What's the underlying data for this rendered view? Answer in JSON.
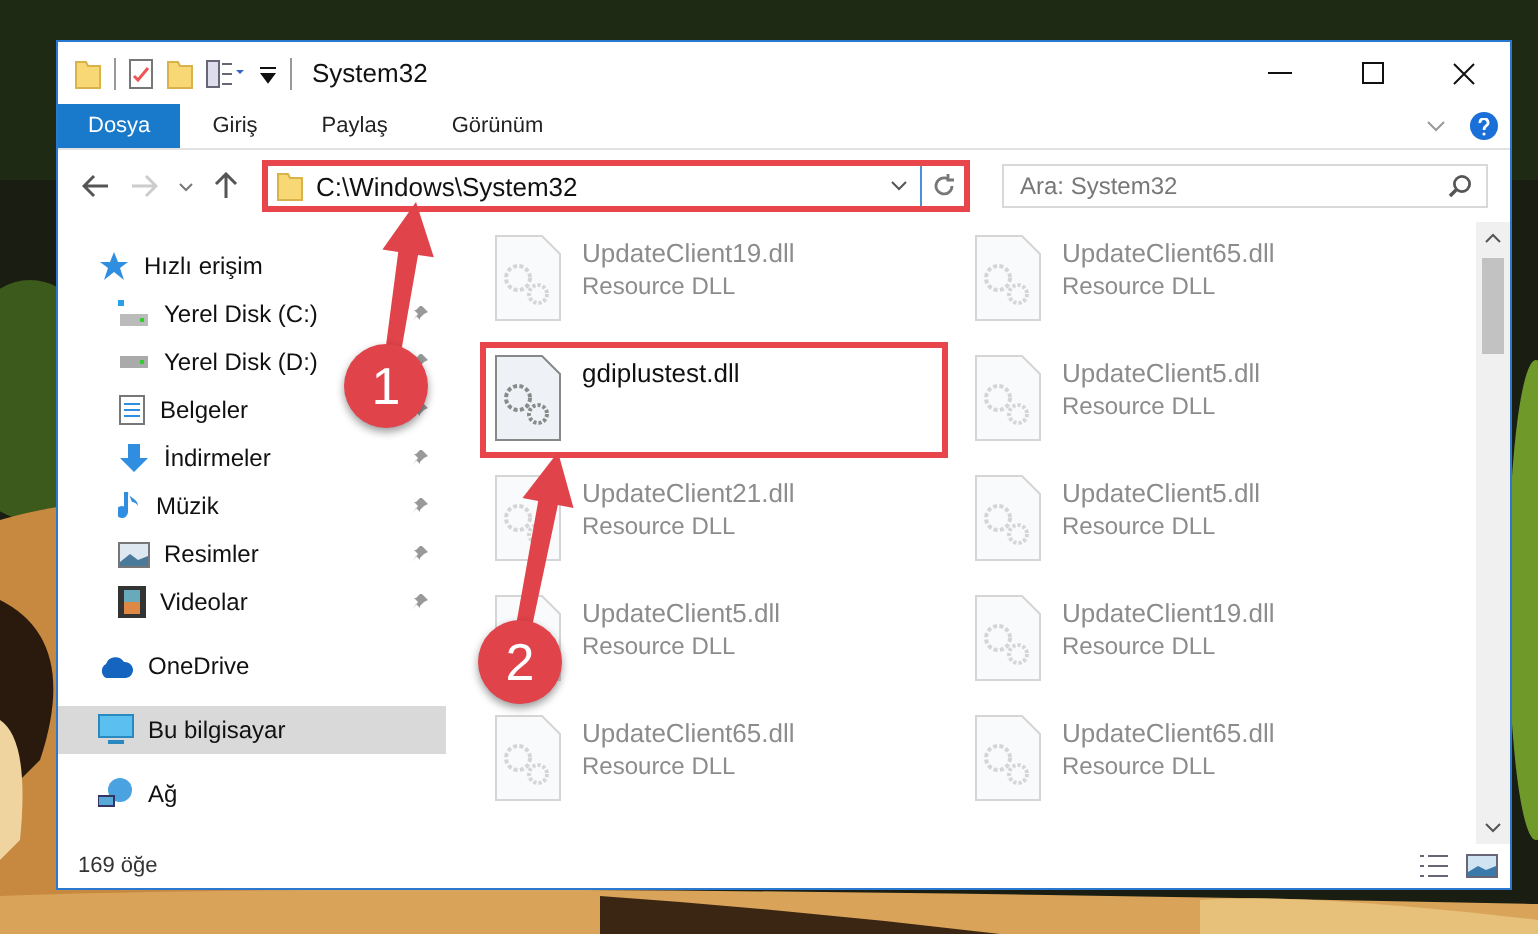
{
  "window": {
    "title": "System32"
  },
  "ribbon_tabs": [
    {
      "label": "Dosya",
      "kind": "file"
    },
    {
      "label": "Giriş",
      "kind": "tab"
    },
    {
      "label": "Paylaş",
      "kind": "tab"
    },
    {
      "label": "Görünüm",
      "kind": "tab"
    }
  ],
  "address_bar": {
    "path": "C:\\Windows\\System32",
    "highlighted": true
  },
  "search": {
    "placeholder": "Ara: System32"
  },
  "sidebar": {
    "items": [
      {
        "label": "Hızlı erişim",
        "selected": false,
        "children": [
          {
            "label": "Yerel Disk (C:)",
            "pinned": true,
            "selected": false
          },
          {
            "label": "Yerel Disk (D:)",
            "pinned": true,
            "selected": false
          },
          {
            "label": "Belgeler",
            "pinned": true,
            "selected": false
          },
          {
            "label": "İndirmeler",
            "pinned": true,
            "selected": false
          },
          {
            "label": "Müzik",
            "pinned": true,
            "selected": false
          },
          {
            "label": "Resimler",
            "pinned": true,
            "selected": false
          },
          {
            "label": "Videolar",
            "pinned": true,
            "selected": false
          }
        ]
      },
      {
        "label": "OneDrive",
        "selected": false
      },
      {
        "label": "Bu bilgisayar",
        "selected": true
      },
      {
        "label": "Ağ",
        "selected": false
      }
    ]
  },
  "files": [
    {
      "name": "UpdateClient19.dll",
      "type": "Resource DLL",
      "blurred": true,
      "highlighted": false
    },
    {
      "name": "UpdateClient65.dll",
      "type": "Resource DLL",
      "blurred": true,
      "highlighted": false
    },
    {
      "name": "gdiplustest.dll",
      "blurred": false,
      "highlighted": true
    },
    {
      "name": "UpdateClient5.dll",
      "type": "Resource DLL",
      "blurred": true,
      "highlighted": false
    },
    {
      "name": "UpdateClient21.dll",
      "type": "Resource DLL",
      "blurred": true,
      "highlighted": false
    },
    {
      "name": "UpdateClient5.dll",
      "type": "Resource DLL",
      "blurred": true,
      "highlighted": false
    },
    {
      "name": "UpdateClient5.dll",
      "type": "Resource DLL",
      "blurred": true,
      "highlighted": false
    },
    {
      "name": "UpdateClient19.dll",
      "type": "Resource DLL",
      "blurred": true,
      "highlighted": false
    },
    {
      "name": "UpdateClient65.dll",
      "type": "Resource DLL",
      "blurred": true,
      "highlighted": false
    },
    {
      "name": "UpdateClient65.dll",
      "type": "Resource DLL",
      "blurred": true,
      "highlighted": false
    }
  ],
  "annotations": [
    {
      "label": "1"
    },
    {
      "label": "2"
    }
  ],
  "status_bar": {
    "count": "169 öğe"
  }
}
